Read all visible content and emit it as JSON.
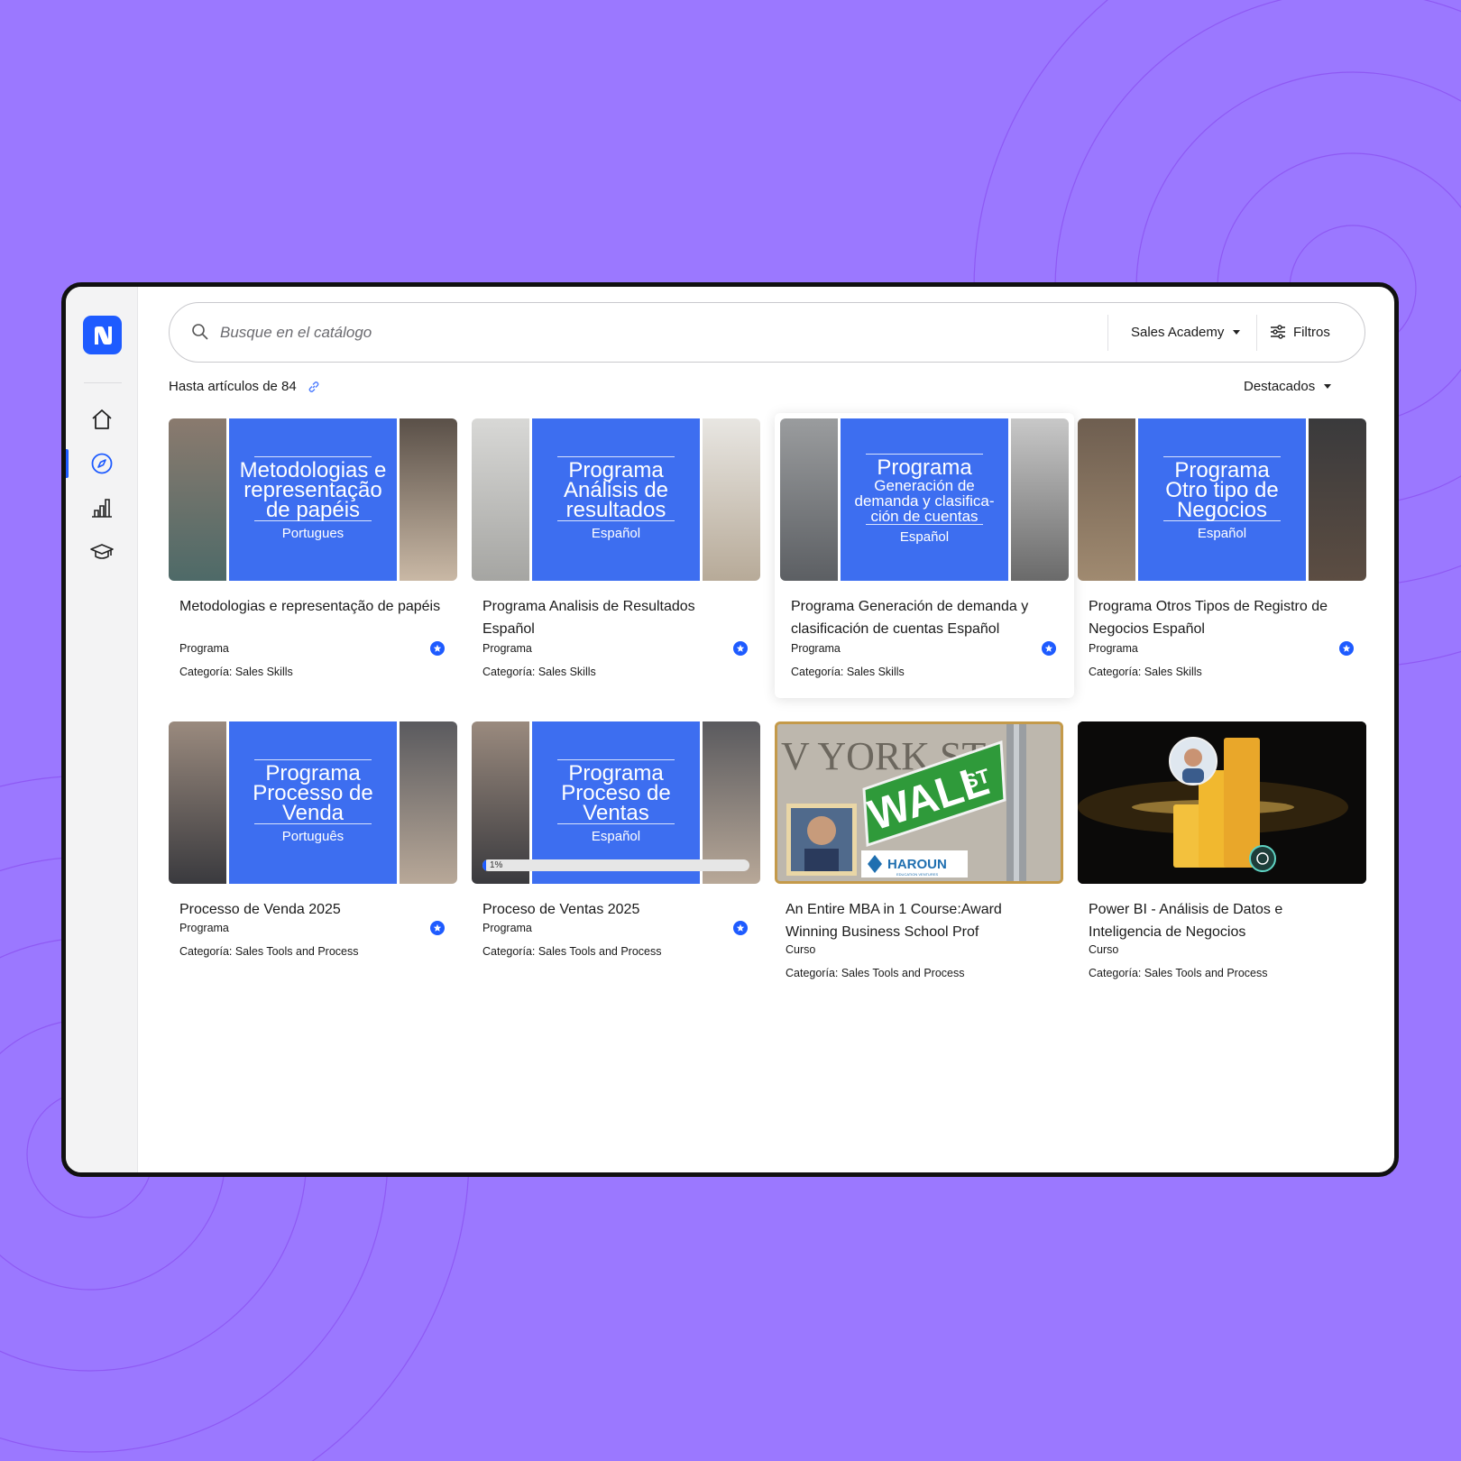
{
  "colors": {
    "background": "#9b78ff",
    "accent": "#1e5bff",
    "panel_blue": "#3d6ef0"
  },
  "sidebar": {
    "logo_letter": "N",
    "items": [
      {
        "icon": "home-icon"
      },
      {
        "icon": "compass-icon",
        "active": true
      },
      {
        "icon": "bar-chart-icon"
      },
      {
        "icon": "graduation-cap-icon"
      }
    ]
  },
  "search": {
    "placeholder": "Busque en el catálogo",
    "value": ""
  },
  "academy_select": {
    "label": "Sales Academy"
  },
  "filters": {
    "label": "Filtros"
  },
  "results": {
    "label": "Hasta artículos de 84"
  },
  "sort": {
    "label": "Destacados"
  },
  "cards": [
    {
      "panel": {
        "t1": "Metodologias e",
        "t2": "representação",
        "t3": "de papéis",
        "lang": "Portugues"
      },
      "title": "Metodologias e representação de papéis",
      "type": "Programa",
      "category": "Categoría: Sales Skills"
    },
    {
      "panel": {
        "t1": "Programa",
        "t2": "Análisis de",
        "t3": "resultados",
        "lang": "Español"
      },
      "title": "Programa Analisis de Resultados Español",
      "type": "Programa",
      "category": "Categoría: Sales Skills"
    },
    {
      "panel": {
        "t1": "Programa",
        "t2": "Generación de",
        "t3": "demanda y clasifica-",
        "t4": "ción de cuentas",
        "lang": "Español"
      },
      "title": "Programa Generación de demanda y clasificación de cuentas Español",
      "type": "Programa",
      "category": "Categoría: Sales Skills"
    },
    {
      "panel": {
        "t1": "Programa",
        "t2": "Otro tipo de",
        "t3": "Negocios",
        "lang": "Español"
      },
      "title": "Programa Otros Tipos de Registro de Negocios Español",
      "type": "Programa",
      "category": "Categoría: Sales Skills"
    },
    {
      "panel": {
        "t1": "Programa",
        "t2": "Processo de",
        "t3": "Venda",
        "lang": "Português"
      },
      "title": "Processo de Venda 2025",
      "type": "Programa",
      "category": "Categoría: Sales Tools and Process"
    },
    {
      "panel": {
        "t1": "Programa",
        "t2": "Proceso de",
        "t3": "Ventas",
        "lang": "Español"
      },
      "title": "Proceso de Ventas 2025",
      "type": "Programa",
      "category": "Categoría: Sales Tools and Process",
      "progress": {
        "value": 0.01,
        "label": "1%"
      }
    },
    {
      "image": {
        "sign_text": "WALL",
        "sign_suffix": "ST",
        "street_text": "V YORK ST",
        "brand": "HAROUN",
        "brand_sub": "EDUCATION VENTURES"
      },
      "title": "An Entire MBA in 1 Course:Award Winning Business School Prof",
      "type": "Curso",
      "category": "Categoría: Sales Tools and Process"
    },
    {
      "title": "Power BI - Análisis de Datos e Inteligencia de Negocios",
      "type": "Curso",
      "category": "Categoría: Sales Tools and Process"
    }
  ]
}
